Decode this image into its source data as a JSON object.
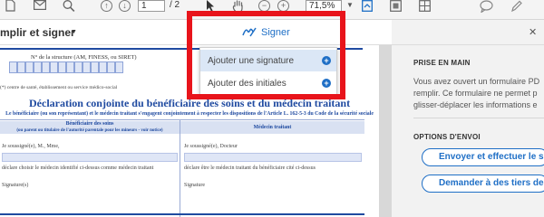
{
  "toolbar": {
    "page_current": "1",
    "page_total": "/ 2",
    "zoom": "71,5%",
    "icons": [
      "page-icon",
      "mail-icon",
      "search-icon",
      "arrow-up-icon",
      "arrow-down-icon",
      "cursor-icon",
      "hand-icon",
      "zoom-out-icon",
      "zoom-in-icon",
      "export-icon",
      "fit-icon",
      "comment-icon",
      "pen-icon"
    ]
  },
  "subbar": {
    "fill_label": "mplir et signer",
    "signer_label": "Signer"
  },
  "menu": {
    "items": [
      {
        "label": "Ajouter une signature",
        "highlighted": true
      },
      {
        "label": "Ajouter des initiales",
        "highlighted": false
      }
    ]
  },
  "document": {
    "field_label": "N° de la structure (AM, FINESS, ou SIRET)",
    "field_note": "(*) centre de santé, établissement ou service médico-social",
    "title": "Déclaration conjointe du bénéficiaire des soins et du médecin traitant",
    "subtitle": "Le bénéficiaire (ou son représentant) et le médecin traitant s'engagent conjointement à respecter les dispositions de l'Article L. 162-5-3 du Code de la sécurité sociale",
    "left_header_1": "Bénéficiaire des soins",
    "left_header_2": "(ou parent ou titulaire de l'autorité parentale pour les mineurs - voir notice)",
    "right_header": "Médecin traitant",
    "left_line_1": "Je soussigné(e), M., Mme,",
    "left_line_2": "déclare choisir le médecin identifié ci-dessus comme médecin traitant",
    "left_line_3": "Signature(s)",
    "right_line_1": "Je soussigné(e), Docteur",
    "right_line_2": "déclare être le médecin traitant du bénéficiaire cité ci-dessus",
    "right_line_3": "Signature"
  },
  "panel": {
    "heading_1": "PRISE EN MAIN",
    "intro_text": "Vous avez ouvert un formulaire PD\nremplir. Ce formulaire ne permet p\nglisser-déplacer les informations e",
    "heading_2": "OPTIONS D'ENVOI",
    "button_1": "Envoyer et effectuer le s",
    "button_2": "Demander à des tiers de s"
  },
  "colors": {
    "accent": "#1f6fc6",
    "highlight": "#e8141b",
    "doc_blue": "#1f4aa0"
  }
}
